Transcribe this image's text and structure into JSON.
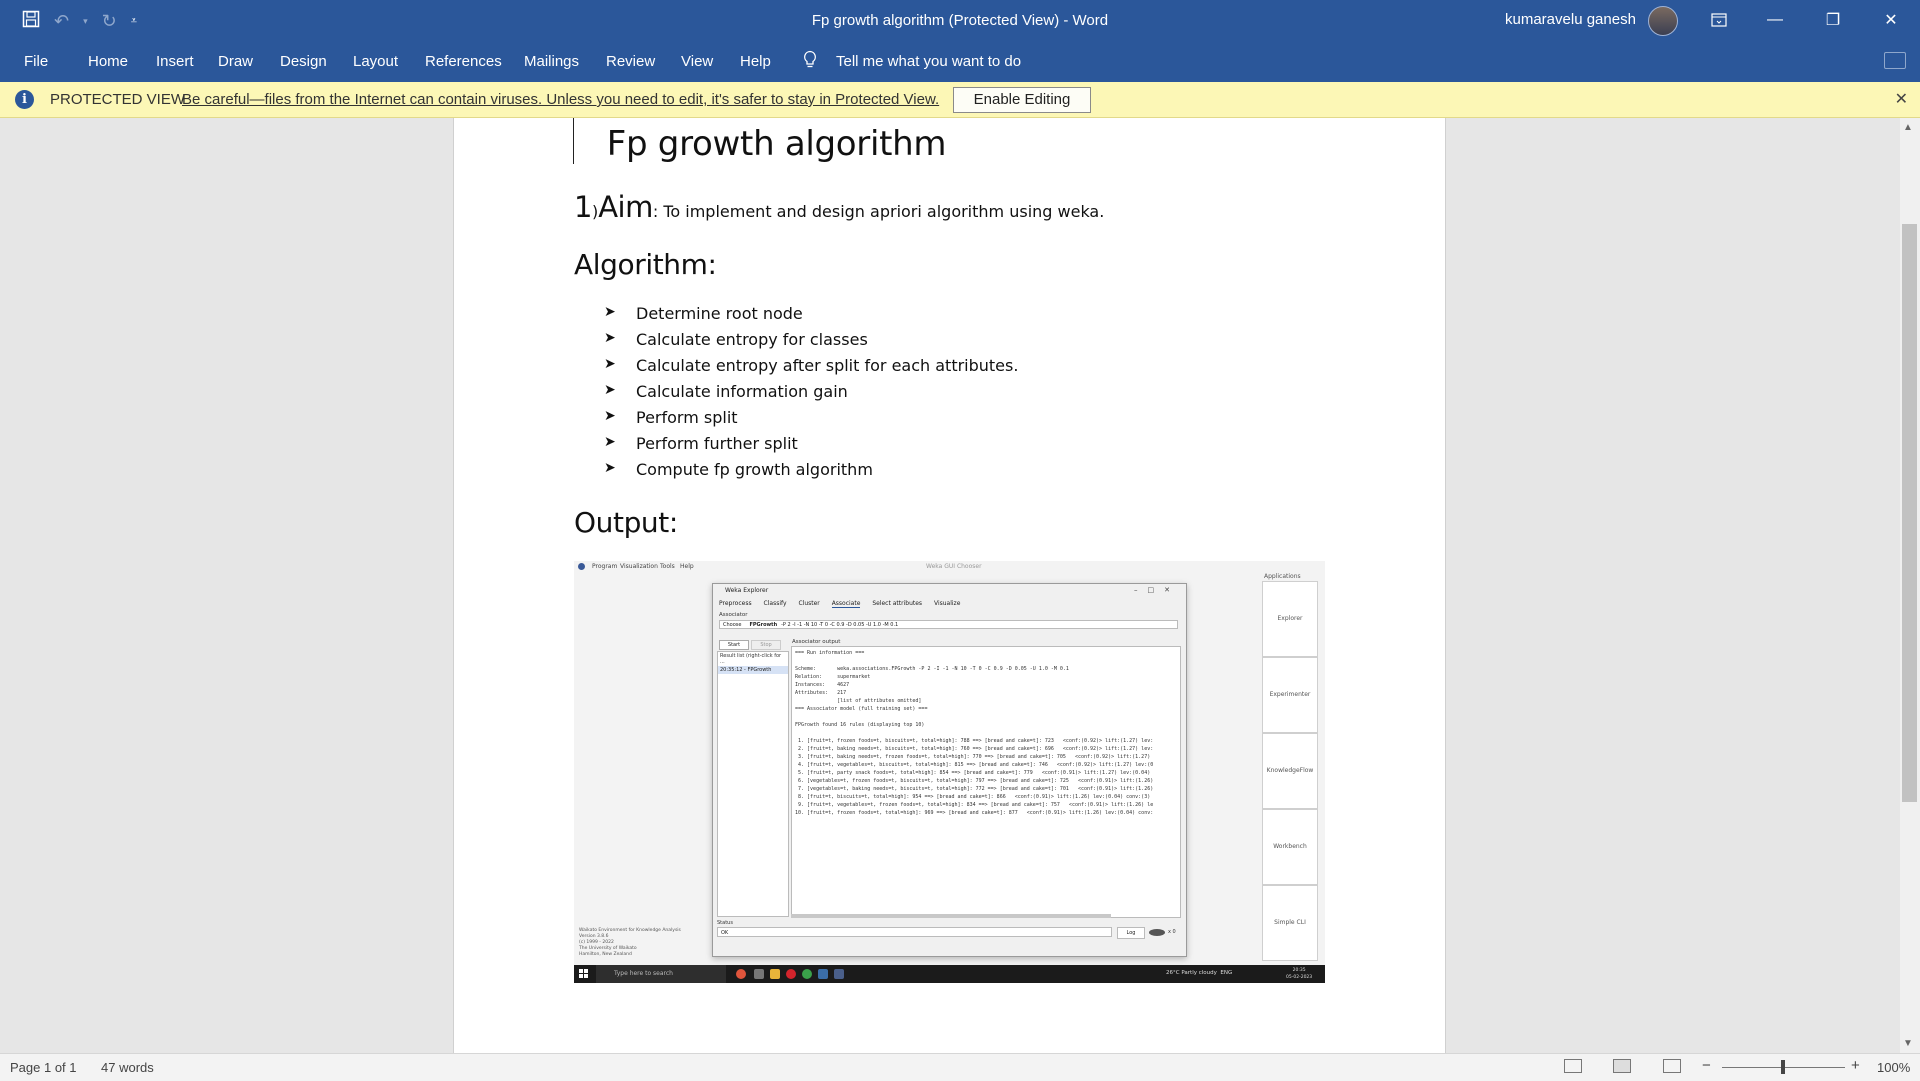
{
  "window": {
    "title": "Fp growth algorithm (Protected View)  -  Word",
    "user": "kumaravelu ganesh"
  },
  "ribbon": {
    "tabs": [
      "File",
      "Home",
      "Insert",
      "Draw",
      "Design",
      "Layout",
      "References",
      "Mailings",
      "Review",
      "View",
      "Help"
    ],
    "tell_me": "Tell me what you want to do"
  },
  "protected_view": {
    "label": "PROTECTED VIEW",
    "message": "Be careful—files from the Internet can contain viruses. Unless you need to edit, it's safer to stay in Protected View.",
    "enable_button": "Enable Editing"
  },
  "document": {
    "title": "Fp growth algorithm",
    "aim_number": "1",
    "aim_paren": ")",
    "aim_word": "Aim",
    "aim_text": ": To implement and design apriori algorithm using weka.",
    "algorithm_heading": "Algorithm:",
    "steps": [
      "Determine root node",
      "Calculate entropy for classes",
      "Calculate entropy after split for each attributes.",
      "Calculate information gain",
      "Perform split",
      "Perform further split",
      "Compute fp growth algorithm"
    ],
    "output_heading": "Output:"
  },
  "embedded_screenshot": {
    "menu": [
      "Program",
      "Visualization",
      "Tools",
      "Help"
    ],
    "gui_chooser_title": "Weka GUI Chooser",
    "apps_header": "Applications",
    "apps": [
      "Explorer",
      "Experimenter",
      "KnowledgeFlow",
      "Workbench",
      "Simple CLI"
    ],
    "credit": [
      "Waikato Environment for Knowledge Analysis",
      "Version 3.8.6",
      "(c) 1999 - 2022",
      "The University of Waikato",
      "Hamilton, New Zealand"
    ],
    "explorer_title": "Weka Explorer",
    "explorer_tabs": [
      "Preprocess",
      "Classify",
      "Cluster",
      "Associate",
      "Select attributes",
      "Visualize"
    ],
    "associator_label": "Associator",
    "choose": "Choose",
    "algorithm": "FPGrowth",
    "options": "-P 2 -I -1 -N 10 -T 0 -C 0.9 -D 0.05 -U 1.0 -M 0.1",
    "start": "Start",
    "stop": "Stop",
    "result_list_header": "Result list (right-click for ...",
    "result_item": "20:35:12 - FPGrowth",
    "output_header": "Associator output",
    "output_lines": [
      "=== Run information ===",
      "",
      "Scheme:       weka.associations.FPGrowth -P 2 -I -1 -N 10 -T 0 -C 0.9 -D 0.05 -U 1.0 -M 0.1",
      "Relation:     supermarket",
      "Instances:    4627",
      "Attributes:   217",
      "              [list of attributes omitted]",
      "=== Associator model (full training set) ===",
      "",
      "FPGrowth found 16 rules (displaying top 10)",
      "",
      " 1. [fruit=t, frozen foods=t, biscuits=t, total=high]: 788 ==> [bread and cake=t]: 723   <conf:(0.92)> lift:(1.27) lev:",
      " 2. [fruit=t, baking needs=t, biscuits=t, total=high]: 760 ==> [bread and cake=t]: 696   <conf:(0.92)> lift:(1.27) lev:",
      " 3. [fruit=t, baking needs=t, frozen foods=t, total=high]: 770 ==> [bread and cake=t]: 705   <conf:(0.92)> lift:(1.27)",
      " 4. [fruit=t, vegetables=t, biscuits=t, total=high]: 815 ==> [bread and cake=t]: 746   <conf:(0.92)> lift:(1.27) lev:(0",
      " 5. [fruit=t, party snack foods=t, total=high]: 854 ==> [bread and cake=t]: 779   <conf:(0.91)> lift:(1.27) lev:(0.04)",
      " 6. [vegetables=t, frozen foods=t, biscuits=t, total=high]: 797 ==> [bread and cake=t]: 725   <conf:(0.91)> lift:(1.26)",
      " 7. [vegetables=t, baking needs=t, biscuits=t, total=high]: 772 ==> [bread and cake=t]: 701   <conf:(0.91)> lift:(1.26)",
      " 8. [fruit=t, biscuits=t, total=high]: 954 ==> [bread and cake=t]: 866   <conf:(0.91)> lift:(1.26) lev:(0.04) conv:(3)",
      " 9. [fruit=t, vegetables=t, frozen foods=t, total=high]: 834 ==> [bread and cake=t]: 757   <conf:(0.91)> lift:(1.26) le",
      "10. [fruit=t, frozen foods=t, total=high]: 969 ==> [bread and cake=t]: 877   <conf:(0.91)> lift:(1.26) lev:(0.04) conv:"
    ],
    "status_label": "Status",
    "status_value": "OK",
    "log": "Log",
    "x_count": "x 0",
    "taskbar_search": "Type here to search",
    "weather": "26°C  Partly cloudy",
    "lang": "ENG",
    "time": "20:35",
    "date": "05-02-2023"
  },
  "statusbar": {
    "page": "Page 1 of 1",
    "words": "47 words",
    "zoom": "100%"
  },
  "colors": {
    "ribbon_blue": "#2b579a",
    "protected_yellow": "#fcf7b6"
  }
}
